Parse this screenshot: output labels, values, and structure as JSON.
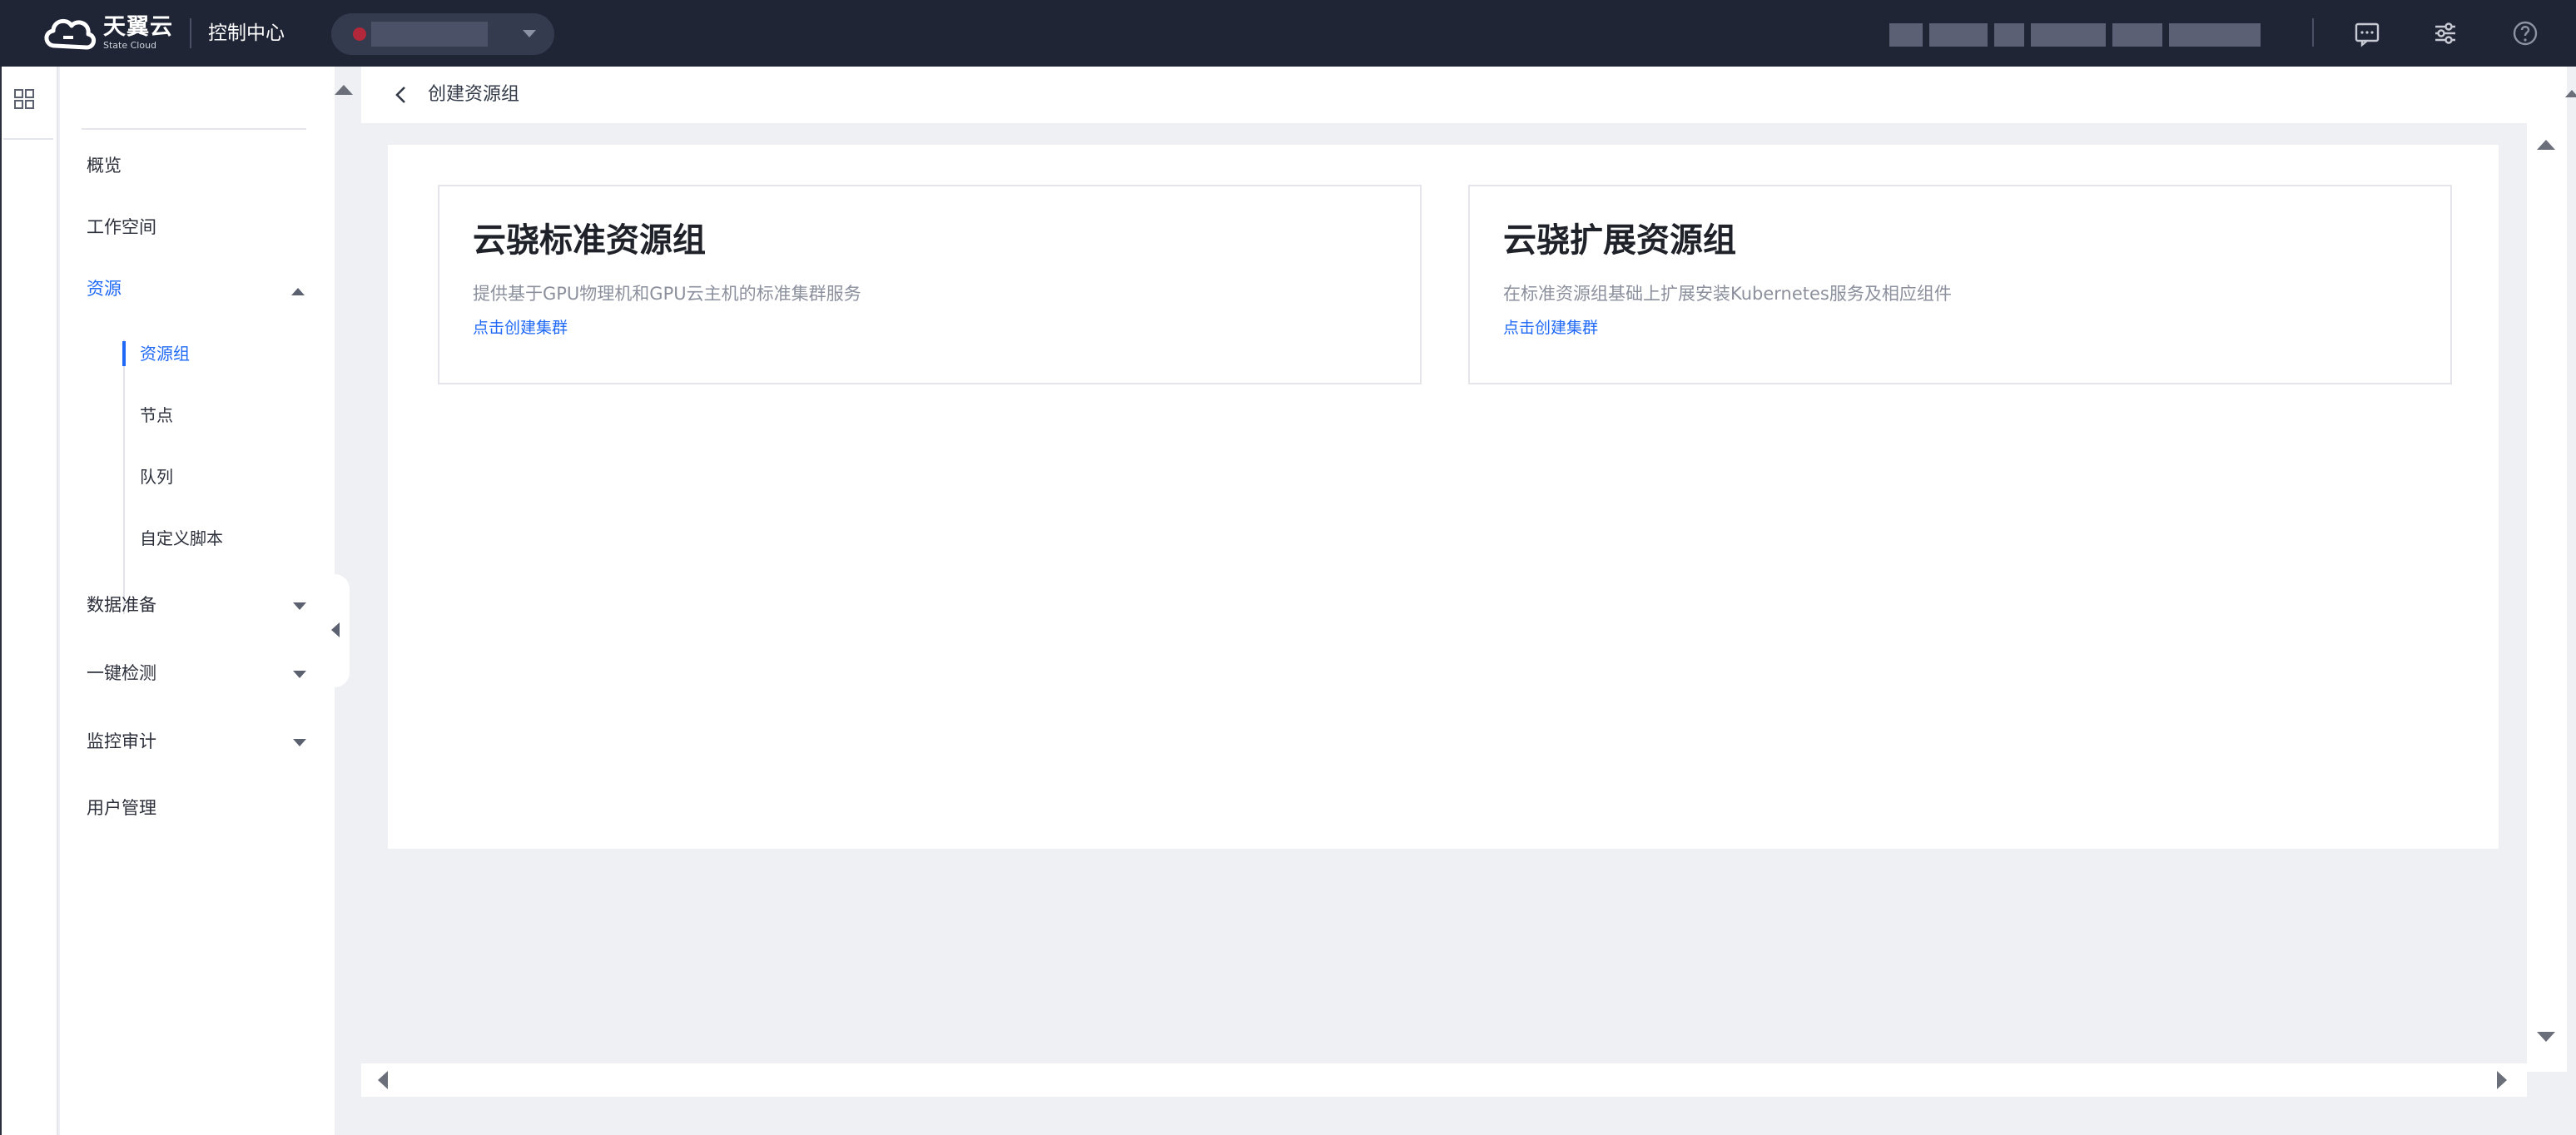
{
  "topbar": {
    "logo_cn": "天翼云",
    "logo_en": "State Cloud",
    "console_title": "控制中心",
    "icons": [
      "message-icon",
      "settings-sliders-icon",
      "help-icon"
    ]
  },
  "sidebar": {
    "items": [
      {
        "label": "概览"
      },
      {
        "label": "工作空间"
      },
      {
        "label": "资源"
      },
      {
        "label": "数据准备"
      },
      {
        "label": "一键检测"
      },
      {
        "label": "监控审计"
      },
      {
        "label": "用户管理"
      }
    ],
    "sub_items": [
      {
        "label": "资源组"
      },
      {
        "label": "节点"
      },
      {
        "label": "队列"
      },
      {
        "label": "自定义脚本"
      }
    ],
    "active_item": "资源",
    "active_sub_item": "资源组"
  },
  "header": {
    "title": "创建资源组"
  },
  "cards": [
    {
      "title": "云骁标准资源组",
      "description": "提供基于GPU物理机和GPU云主机的标准集群服务",
      "link": "点击创建集群"
    },
    {
      "title": "云骁扩展资源组",
      "description": "在标准资源组基础上扩展安装Kubernetes服务及相应组件",
      "link": "点击创建集群"
    }
  ],
  "colors": {
    "topbar_bg": "#202536",
    "accent": "#1f69f6",
    "page_bg": "#eff0f4"
  }
}
